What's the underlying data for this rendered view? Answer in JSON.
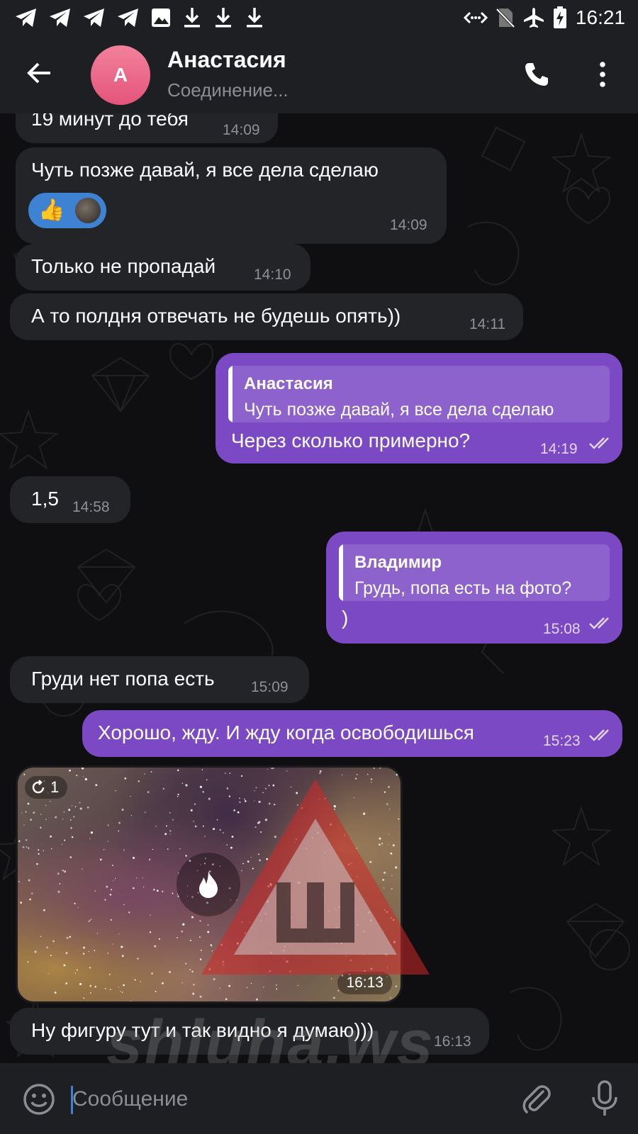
{
  "status_bar": {
    "time": "16:21",
    "left_icons": [
      "telegram-icon",
      "telegram-icon",
      "telegram-icon",
      "telegram-icon",
      "gallery-icon",
      "download-icon",
      "download-icon",
      "download-icon"
    ],
    "right_icons": [
      "data-saver-icon",
      "no-sim-icon",
      "airplane-icon",
      "battery-charging-icon"
    ]
  },
  "header": {
    "avatar_initial": "А",
    "name": "Анастасия",
    "status": "Соединение...",
    "avatar_color": "#e4547a"
  },
  "messages": [
    {
      "dir": "in",
      "text": "19 минут до тебя",
      "time": "14:09"
    },
    {
      "dir": "in",
      "text": "Чуть позже давай, я все дела сделаю",
      "time": "14:09",
      "reaction": "👍"
    },
    {
      "dir": "in",
      "text": "Только не пропадай",
      "time": "14:10"
    },
    {
      "dir": "in",
      "text": "А то полдня отвечать не будешь опять))",
      "time": "14:11"
    },
    {
      "dir": "out",
      "reply_name": "Анастасия",
      "reply_text": "Чуть позже давай, я все дела сделаю",
      "text": "Через сколько примерно?",
      "time": "14:19"
    },
    {
      "dir": "in",
      "text": "1,5",
      "time": "14:58"
    },
    {
      "dir": "out",
      "reply_name": "Владимир",
      "reply_text": "Грудь, попа есть на фото?",
      "text": ")",
      "time": "15:08"
    },
    {
      "dir": "in",
      "text": "Груди нет попа есть",
      "time": "15:09"
    },
    {
      "dir": "out",
      "text": "Хорошо, жду. И жду когда освободишься",
      "time": "15:23"
    },
    {
      "dir": "in",
      "type": "photo",
      "views": "1",
      "time": "16:13"
    },
    {
      "dir": "in",
      "text": "Ну фигуру тут и так видно я думаю)))",
      "time": "16:13"
    }
  ],
  "watermark": "shluha.ws",
  "input": {
    "placeholder": "Сообщение"
  },
  "colors": {
    "outgoing_bubble": "#7c49c4",
    "incoming_bubble": "#232428",
    "background": "#0f0f11",
    "bars": "#1e1f23",
    "accent": "#3e83d3"
  }
}
